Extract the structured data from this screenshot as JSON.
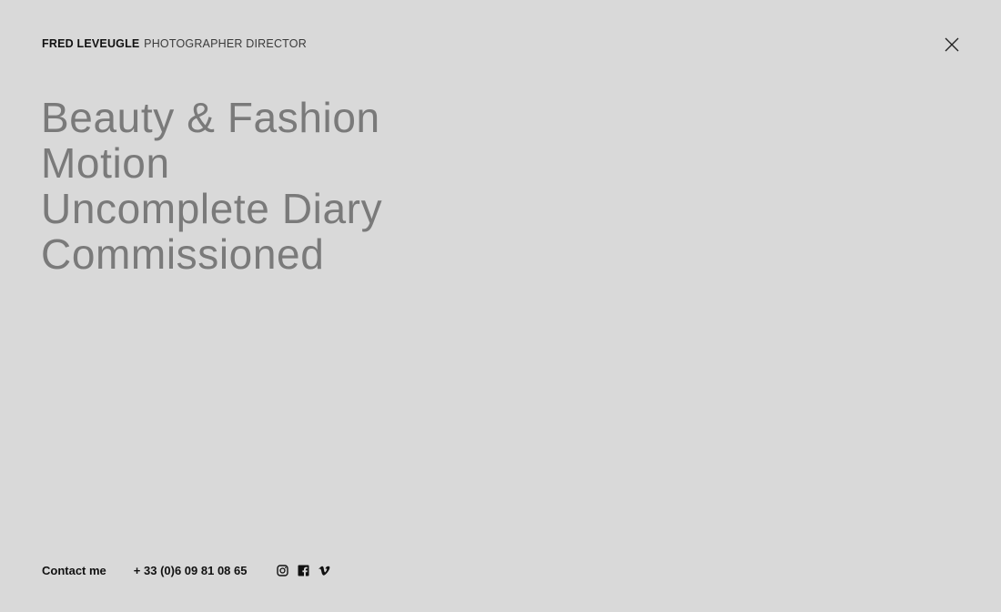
{
  "header": {
    "name": "FRED LEVEUGLE",
    "role": "PHOTOGRAPHER DIRECTOR",
    "close_icon": "close-icon"
  },
  "menu": {
    "items": [
      {
        "label": "Beauty & Fashion"
      },
      {
        "label": "Motion"
      },
      {
        "label": "Uncomplete Diary"
      },
      {
        "label": "Commissioned"
      }
    ]
  },
  "footer": {
    "contact_label": "Contact me",
    "phone": "+ 33 (0)6 09 81 08 65",
    "socials": [
      {
        "icon": "instagram-icon"
      },
      {
        "icon": "facebook-icon"
      },
      {
        "icon": "vimeo-icon"
      }
    ]
  },
  "colors": {
    "background": "#d9d9d9",
    "menu_text": "#7a7a7a",
    "text": "#111111"
  }
}
